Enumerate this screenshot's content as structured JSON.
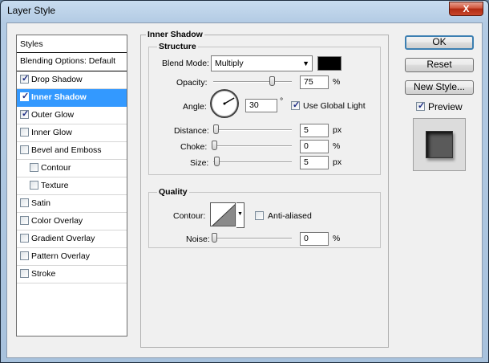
{
  "window": {
    "title": "Layer Style",
    "close_glyph": "X"
  },
  "styles_list": {
    "header": "Styles",
    "blending": "Blending Options: Default",
    "items": [
      {
        "label": "Drop Shadow",
        "checked": true,
        "selected": false,
        "indent": false
      },
      {
        "label": "Inner Shadow",
        "checked": true,
        "selected": true,
        "indent": false
      },
      {
        "label": "Outer Glow",
        "checked": true,
        "selected": false,
        "indent": false
      },
      {
        "label": "Inner Glow",
        "checked": false,
        "selected": false,
        "indent": false
      },
      {
        "label": "Bevel and Emboss",
        "checked": false,
        "selected": false,
        "indent": false
      },
      {
        "label": "Contour",
        "checked": false,
        "selected": false,
        "indent": true
      },
      {
        "label": "Texture",
        "checked": false,
        "selected": false,
        "indent": true
      },
      {
        "label": "Satin",
        "checked": false,
        "selected": false,
        "indent": false
      },
      {
        "label": "Color Overlay",
        "checked": false,
        "selected": false,
        "indent": false
      },
      {
        "label": "Gradient Overlay",
        "checked": false,
        "selected": false,
        "indent": false
      },
      {
        "label": "Pattern Overlay",
        "checked": false,
        "selected": false,
        "indent": false
      },
      {
        "label": "Stroke",
        "checked": false,
        "selected": false,
        "indent": false
      }
    ]
  },
  "panel": {
    "title": "Inner Shadow",
    "structure": {
      "title": "Structure",
      "blend_mode_label": "Blend Mode:",
      "blend_mode_value": "Multiply",
      "shadow_color": "#000000",
      "opacity_label": "Opacity:",
      "opacity_value": "75",
      "opacity_level": 0.75,
      "angle_label": "Angle:",
      "angle_value": "30",
      "degree_symbol": "°",
      "use_global_light_label": "Use Global Light",
      "use_global_light_checked": true,
      "distance_label": "Distance:",
      "distance_value": "5",
      "choke_label": "Choke:",
      "choke_value": "0",
      "size_label": "Size:",
      "size_value": "5",
      "unit_px": "px",
      "unit_pct": "%"
    },
    "quality": {
      "title": "Quality",
      "contour_label": "Contour:",
      "anti_aliased_label": "Anti-aliased",
      "anti_aliased_checked": false,
      "noise_label": "Noise:",
      "noise_value": "0",
      "unit_pct": "%"
    }
  },
  "buttons": {
    "ok": "OK",
    "reset": "Reset",
    "new_style": "New Style...",
    "preview_label": "Preview",
    "preview_checked": true
  },
  "icons": {
    "close": "close-icon",
    "dropdown": "chevron-down-icon"
  }
}
